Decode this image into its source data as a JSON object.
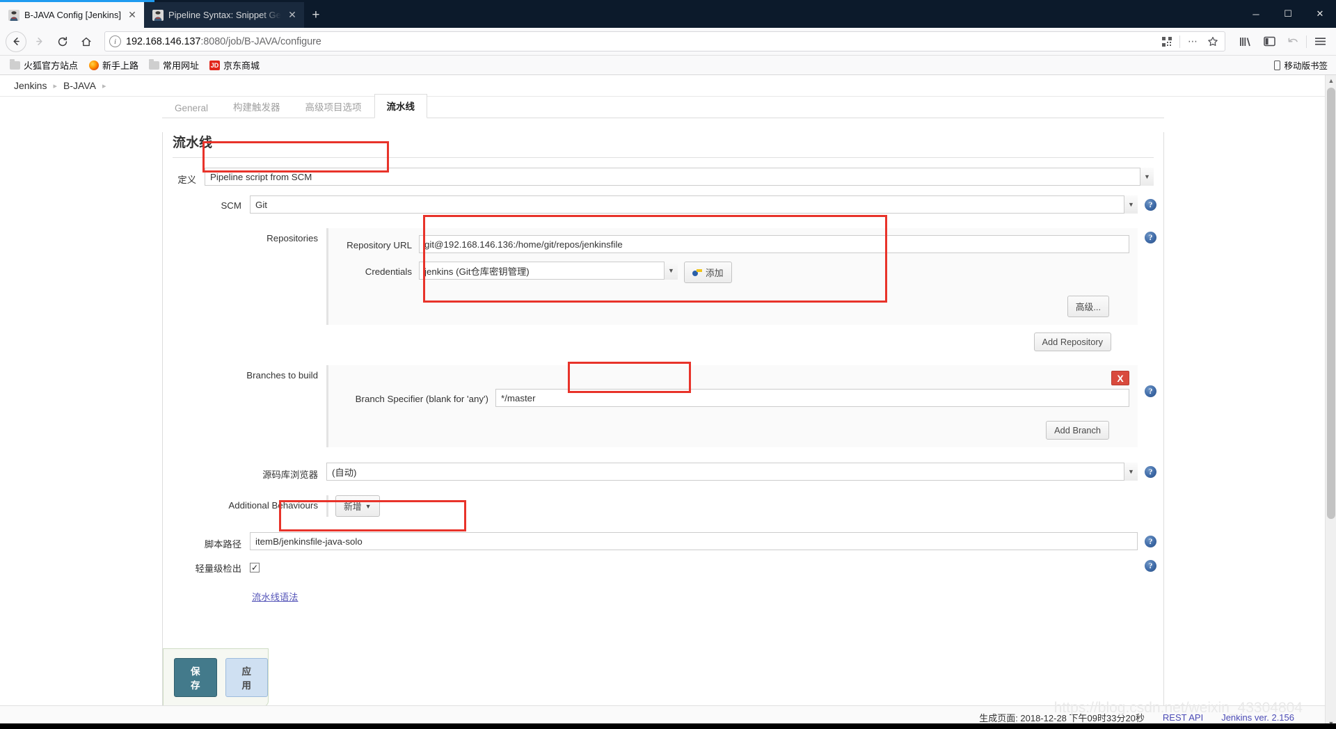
{
  "browser": {
    "tabs": [
      {
        "title": "B-JAVA Config [Jenkins]",
        "favicon": "jenkins-icon",
        "active": true
      },
      {
        "title": "Pipeline Syntax: Snippet Gen",
        "favicon": "jenkins-icon",
        "active": false
      }
    ],
    "newtab_label": "+",
    "window_controls": {
      "minimize": "─",
      "maximize": "☐",
      "close": "✕"
    },
    "nav": {
      "back": "←",
      "forward": "→",
      "reload": "⟳",
      "home": "⌂"
    },
    "url": {
      "host": "192.168.146.137",
      "rest": ":8080/job/B-JAVA/configure",
      "full": "192.168.146.137:8080/job/B-JAVA/configure"
    },
    "url_icons": [
      "qr-code-icon",
      "ellipsis-icon",
      "star-icon"
    ],
    "toolbar_icons": [
      "library-icon",
      "sidebar-icon",
      "undo-icon",
      "hamburger-menu-icon"
    ],
    "bookmarks": [
      {
        "label": "火狐官方站点",
        "icon": "folder-icon"
      },
      {
        "label": "新手上路",
        "icon": "firefox-icon"
      },
      {
        "label": "常用网址",
        "icon": "folder-icon"
      },
      {
        "label": "京东商城",
        "icon": "jd-icon"
      }
    ],
    "bookmarks_right": {
      "label": "移动版书签",
      "icon": "mobile-icon"
    }
  },
  "jenkins": {
    "breadcrumb": [
      "Jenkins",
      "B-JAVA"
    ],
    "tabs": [
      {
        "label": "General",
        "active": false
      },
      {
        "label": "构建触发器",
        "active": false
      },
      {
        "label": "高级项目选项",
        "active": false
      },
      {
        "label": "流水线",
        "active": true
      }
    ],
    "section_title": "流水线",
    "definition": {
      "label": "定义",
      "value": "Pipeline script from SCM",
      "highlighted": true
    },
    "scm": {
      "label": "SCM",
      "value": "Git"
    },
    "repositories": {
      "label": "Repositories",
      "repository_url": {
        "label": "Repository URL",
        "value": "git@192.168.146.136:/home/git/repos/jenkinsfile"
      },
      "credentials": {
        "label": "Credentials",
        "value": "jenkins (Git仓库密钥管理)",
        "add_button": "添加"
      },
      "advanced_button": "高级...",
      "add_repository_button": "Add Repository"
    },
    "branches": {
      "label": "Branches to build",
      "specifier": {
        "label": "Branch Specifier (blank for 'any')",
        "value": "*/master"
      },
      "delete_button": "X",
      "add_branch_button": "Add Branch"
    },
    "repo_browser": {
      "label": "源码库浏览器",
      "value": "(自动)"
    },
    "additional_behaviours": {
      "label": "Additional Behaviours",
      "button": "新增"
    },
    "script_path": {
      "label": "脚本路径",
      "value": "itemB/jenkinsfile-java-solo"
    },
    "lightweight": {
      "label": "轻量级检出",
      "checked": true,
      "mark": "✓"
    },
    "pipeline_syntax_link": "流水线语法",
    "actions": {
      "save": "保存",
      "apply": "应用"
    },
    "footer": {
      "generated": "生成页面: 2018-12-28 下午09时33分20秒",
      "rest_api": "REST API",
      "version": "Jenkins ver. 2.156"
    },
    "help_icon_label": "?"
  },
  "watermark": "https://blog.csdn.net/weixin_43304804",
  "colors": {
    "accent": "#1f9bf0",
    "highlight": "#e8332a",
    "save": "#437a8b",
    "apply": "#cfe0f2",
    "help": "#3f6ba8",
    "delete": "#d94a3d"
  }
}
